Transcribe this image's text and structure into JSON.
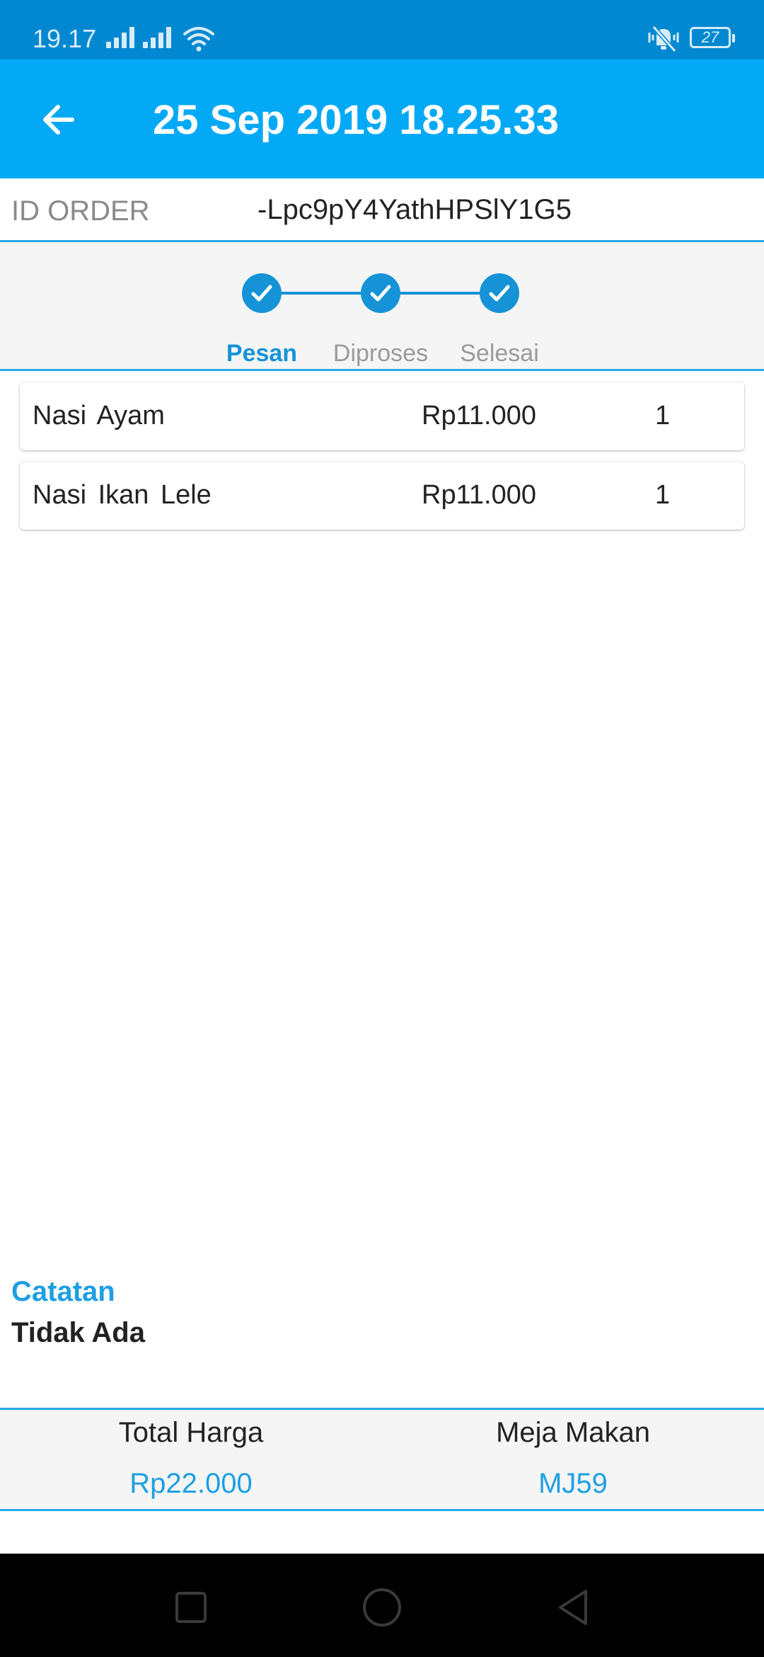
{
  "status_bar": {
    "time": "19.17",
    "battery": "27",
    "icons": [
      "signal-icon",
      "signal-icon",
      "wifi-icon",
      "mute-vibrate-icon",
      "battery-icon"
    ]
  },
  "app_bar": {
    "title": "25 Sep 2019 18.25.33",
    "back_icon": "arrow-left-icon"
  },
  "order": {
    "label": "ID ORDER",
    "value": "-Lpc9pY4YathHPSlY1G5"
  },
  "stepper": {
    "steps": [
      {
        "label": "Pesan",
        "done": true,
        "active": true
      },
      {
        "label": "Diproses",
        "done": true,
        "active": false
      },
      {
        "label": "Selesai",
        "done": true,
        "active": false
      }
    ]
  },
  "items": [
    {
      "name": "Nasi Ayam",
      "price": "Rp11.000",
      "qty": "1"
    },
    {
      "name": "Nasi Ikan Lele",
      "price": "Rp11.000",
      "qty": "1"
    }
  ],
  "notes": {
    "title": "Catatan",
    "value": "Tidak Ada"
  },
  "summary": {
    "total_label": "Total Harga",
    "total_value": "Rp22.000",
    "table_label": "Meja Makan",
    "table_value": "MJ59"
  },
  "colors": {
    "status_bar": "#0288d1",
    "app_bar": "#03a9f4",
    "accent": "#1e9fe3",
    "step": "#1593d6"
  },
  "nav_bar": {
    "icons": [
      "recents-square-icon",
      "home-circle-icon",
      "back-triangle-icon"
    ]
  }
}
